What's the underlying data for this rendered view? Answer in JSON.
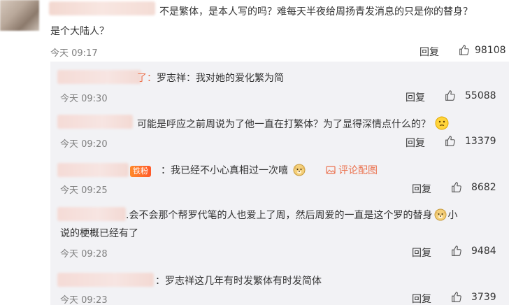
{
  "main": {
    "text_line1": "不是繁体，是本人写的吗？难每天半夜给周扬青发消息的只是你的替身？",
    "text_line2": "是个大陆人？",
    "time": "今天 09:17",
    "reply_label": "回复",
    "likes": "98108"
  },
  "replies": [
    {
      "suffix": "了：",
      "text": "罗志祥：我对她的爱化繁为简",
      "time": "今天 09:30",
      "reply_label": "回复",
      "likes": "55088"
    },
    {
      "text": "可能是呼应之前周说为了他一直在打繁体？为了显得深情点什么的？",
      "time": "今天 09:20",
      "reply_label": "回复",
      "likes": "13379"
    },
    {
      "badge": "铁粉",
      "text": "：我已经不小心真相过一次嘻",
      "link": "评论配图",
      "time": "今天 09:25",
      "reply_label": "回复",
      "likes": "8682"
    },
    {
      "text_line1": ".会不会那个帮罗代笔的人也爱上了周，然后周爱的一直是这个罗的替身",
      "text_line1_end": "小",
      "text_line2": "说的梗概已经有了",
      "time": "今天 09:28",
      "reply_label": "回复",
      "likes": "9484"
    },
    {
      "text": "：罗志祥这几年有时发繁体有时发简体",
      "time": "今天 09:23",
      "reply_label": "回复",
      "likes": "3739"
    }
  ],
  "icons": {
    "like": "thumbs-up-icon",
    "emoji_think": "thinking-face-icon",
    "emoji_doge": "doge-icon",
    "image": "image-icon"
  },
  "colors": {
    "link": "#eb7350",
    "time": "#808080",
    "reply_bg": "#f2f2f5"
  }
}
